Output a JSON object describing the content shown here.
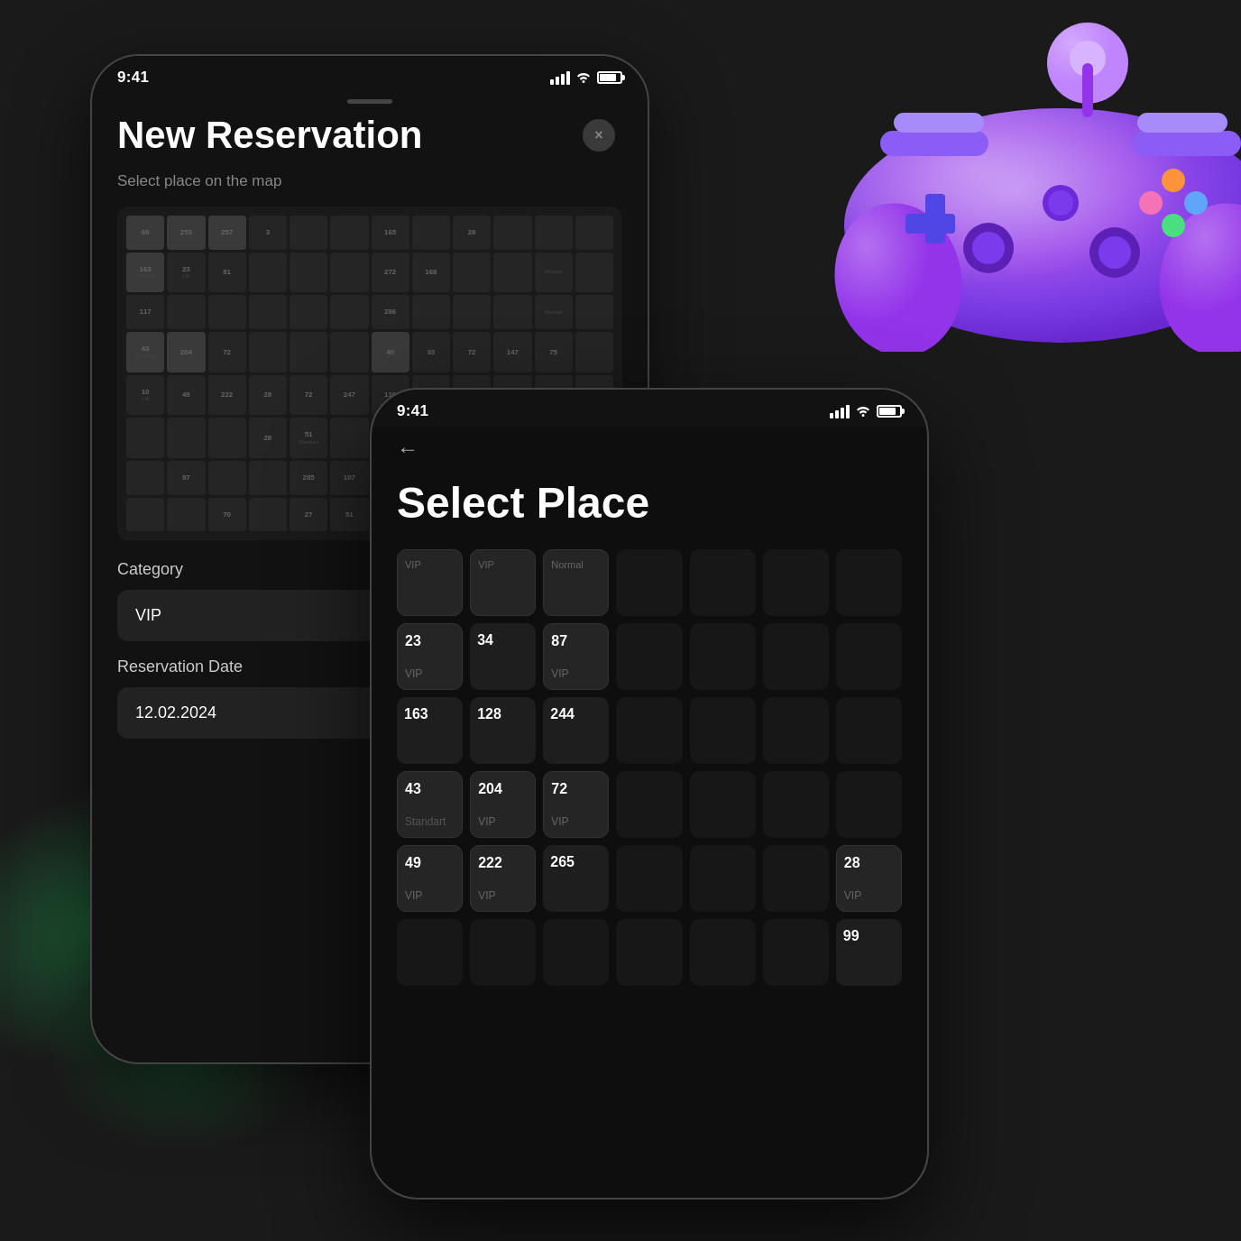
{
  "background": {
    "color": "#1a1a1a"
  },
  "phone_back": {
    "status_bar": {
      "time": "9:41",
      "signal": "full",
      "wifi": true,
      "battery": "full"
    },
    "close_button_label": "×",
    "title": "New Reservation",
    "subtitle": "Select place on the map",
    "seat_map": {
      "rows": 8,
      "cols": 12,
      "sample_seats": [
        {
          "num": "69",
          "type": ""
        },
        {
          "num": "253",
          "type": ""
        },
        {
          "num": "257",
          "type": ""
        },
        {
          "num": "3",
          "type": ""
        },
        {
          "num": "163",
          "type": ""
        },
        {
          "num": "23",
          "type": ""
        },
        {
          "num": "81",
          "type": ""
        },
        {
          "num": "117",
          "type": ""
        },
        {
          "num": "43",
          "type": ""
        },
        {
          "num": "204",
          "type": ""
        },
        {
          "num": "72",
          "type": ""
        },
        {
          "num": "10",
          "type": ""
        },
        {
          "num": "49",
          "type": ""
        },
        {
          "num": "222",
          "type": ""
        }
      ]
    },
    "category_label": "Category",
    "category_value": "VIP",
    "reservation_date_label": "Reservation Date",
    "reservation_date_value": "12.02.2024"
  },
  "phone_front": {
    "status_bar": {
      "time": "9:41",
      "signal": "full",
      "wifi": true,
      "battery": "full"
    },
    "back_arrow": "←",
    "title": "Select Place",
    "seat_rows": [
      {
        "row_id": "row0",
        "seats": [
          {
            "num": "",
            "type": "VIP",
            "state": "header"
          },
          {
            "num": "",
            "type": "VIP",
            "state": "header"
          },
          {
            "num": "",
            "type": "Normal",
            "state": "header"
          },
          {
            "num": "",
            "type": "",
            "state": "empty"
          },
          {
            "num": "",
            "type": "",
            "state": "empty"
          },
          {
            "num": "",
            "type": "",
            "state": "empty"
          },
          {
            "num": "",
            "type": "",
            "state": "empty"
          }
        ]
      },
      {
        "row_id": "row1",
        "seats": [
          {
            "num": "23",
            "type": "VIP",
            "state": "selected"
          },
          {
            "num": "34",
            "type": "",
            "state": "normal"
          },
          {
            "num": "87",
            "type": "VIP",
            "state": "selected"
          },
          {
            "num": "",
            "type": "",
            "state": "empty"
          },
          {
            "num": "",
            "type": "",
            "state": "empty"
          },
          {
            "num": "",
            "type": "",
            "state": "empty"
          },
          {
            "num": "",
            "type": "",
            "state": "empty"
          }
        ]
      },
      {
        "row_id": "row2",
        "seats": [
          {
            "num": "163",
            "type": "",
            "state": "dim"
          },
          {
            "num": "128",
            "type": "",
            "state": "dim"
          },
          {
            "num": "244",
            "type": "",
            "state": "dim"
          },
          {
            "num": "",
            "type": "",
            "state": "empty"
          },
          {
            "num": "",
            "type": "",
            "state": "empty"
          },
          {
            "num": "",
            "type": "",
            "state": "empty"
          },
          {
            "num": "",
            "type": "",
            "state": "empty"
          }
        ]
      },
      {
        "row_id": "row3",
        "seats": [
          {
            "num": "43",
            "type": "Standart",
            "state": "selected"
          },
          {
            "num": "204",
            "type": "VIP",
            "state": "selected"
          },
          {
            "num": "72",
            "type": "VIP",
            "state": "selected"
          },
          {
            "num": "",
            "type": "",
            "state": "empty"
          },
          {
            "num": "",
            "type": "",
            "state": "empty"
          },
          {
            "num": "",
            "type": "",
            "state": "empty"
          },
          {
            "num": "",
            "type": "",
            "state": "empty"
          }
        ]
      },
      {
        "row_id": "row4",
        "seats": [
          {
            "num": "49",
            "type": "VIP",
            "state": "selected"
          },
          {
            "num": "222",
            "type": "VIP",
            "state": "selected"
          },
          {
            "num": "265",
            "type": "",
            "state": "dim"
          },
          {
            "num": "",
            "type": "",
            "state": "empty"
          },
          {
            "num": "",
            "type": "",
            "state": "empty"
          },
          {
            "num": "",
            "type": "",
            "state": "empty"
          },
          {
            "num": "28",
            "type": "VIP",
            "state": "selected"
          }
        ]
      },
      {
        "row_id": "row5",
        "seats": [
          {
            "num": "",
            "type": "",
            "state": "empty"
          },
          {
            "num": "",
            "type": "",
            "state": "empty"
          },
          {
            "num": "",
            "type": "",
            "state": "empty"
          },
          {
            "num": "",
            "type": "",
            "state": "empty"
          },
          {
            "num": "",
            "type": "",
            "state": "empty"
          },
          {
            "num": "",
            "type": "",
            "state": "empty"
          },
          {
            "num": "99",
            "type": "",
            "state": "dim"
          }
        ]
      }
    ]
  }
}
